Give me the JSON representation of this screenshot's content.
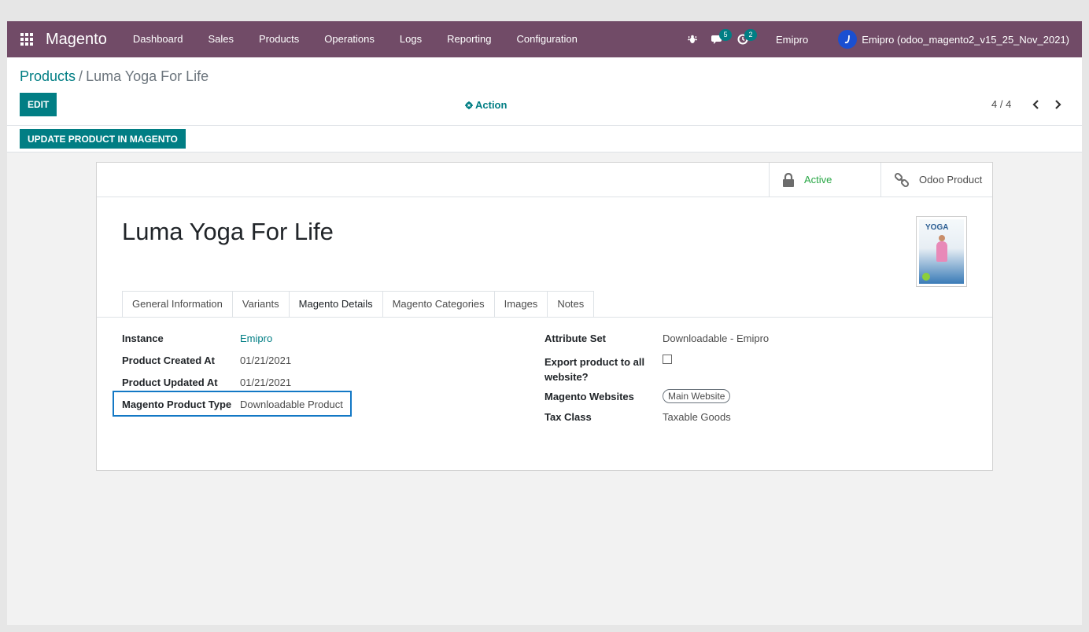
{
  "navbar": {
    "brand": "Magento",
    "menu": [
      "Dashboard",
      "Sales",
      "Products",
      "Operations",
      "Logs",
      "Reporting",
      "Configuration"
    ],
    "messages_count": "5",
    "activities_count": "2",
    "company": "Emipro",
    "user": "Emipro (odoo_magento2_v15_25_Nov_2021)"
  },
  "breadcrumb": {
    "parent": "Products",
    "separator": "/",
    "current": "Luma Yoga For Life"
  },
  "control": {
    "edit_label": "EDIT",
    "action_label": "Action",
    "pager": "4 / 4"
  },
  "statusbar": {
    "update_label": "UPDATE PRODUCT IN MAGENTO"
  },
  "smart_buttons": {
    "active_label": "Active",
    "odoo_product_label": "Odoo Product"
  },
  "product": {
    "title": "Luma Yoga For Life",
    "cover_text_1": "YOGA"
  },
  "tabs": [
    "General Information",
    "Variants",
    "Magento Details",
    "Magento Categories",
    "Images",
    "Notes"
  ],
  "fields_left": [
    {
      "label": "Instance",
      "value": "Emipro"
    },
    {
      "label": "Product Created At",
      "value": "01/21/2021"
    },
    {
      "label": "Product Updated At",
      "value": "01/21/2021"
    },
    {
      "label": "Magento Product Type",
      "value": "Downloadable Product"
    }
  ],
  "fields_right": {
    "attribute_set_label": "Attribute Set",
    "attribute_set_value": "Downloadable - Emipro",
    "export_label_1": "Export product to all",
    "export_label_2": "website?",
    "websites_label": "Magento Websites",
    "websites_tag": "Main Website",
    "tax_class_label": "Tax Class",
    "tax_class_value": "Taxable Goods"
  },
  "colors": {
    "navbar": "#714b67",
    "primary": "#017e84",
    "active_green": "#28a745",
    "highlight": "#1378c5"
  }
}
